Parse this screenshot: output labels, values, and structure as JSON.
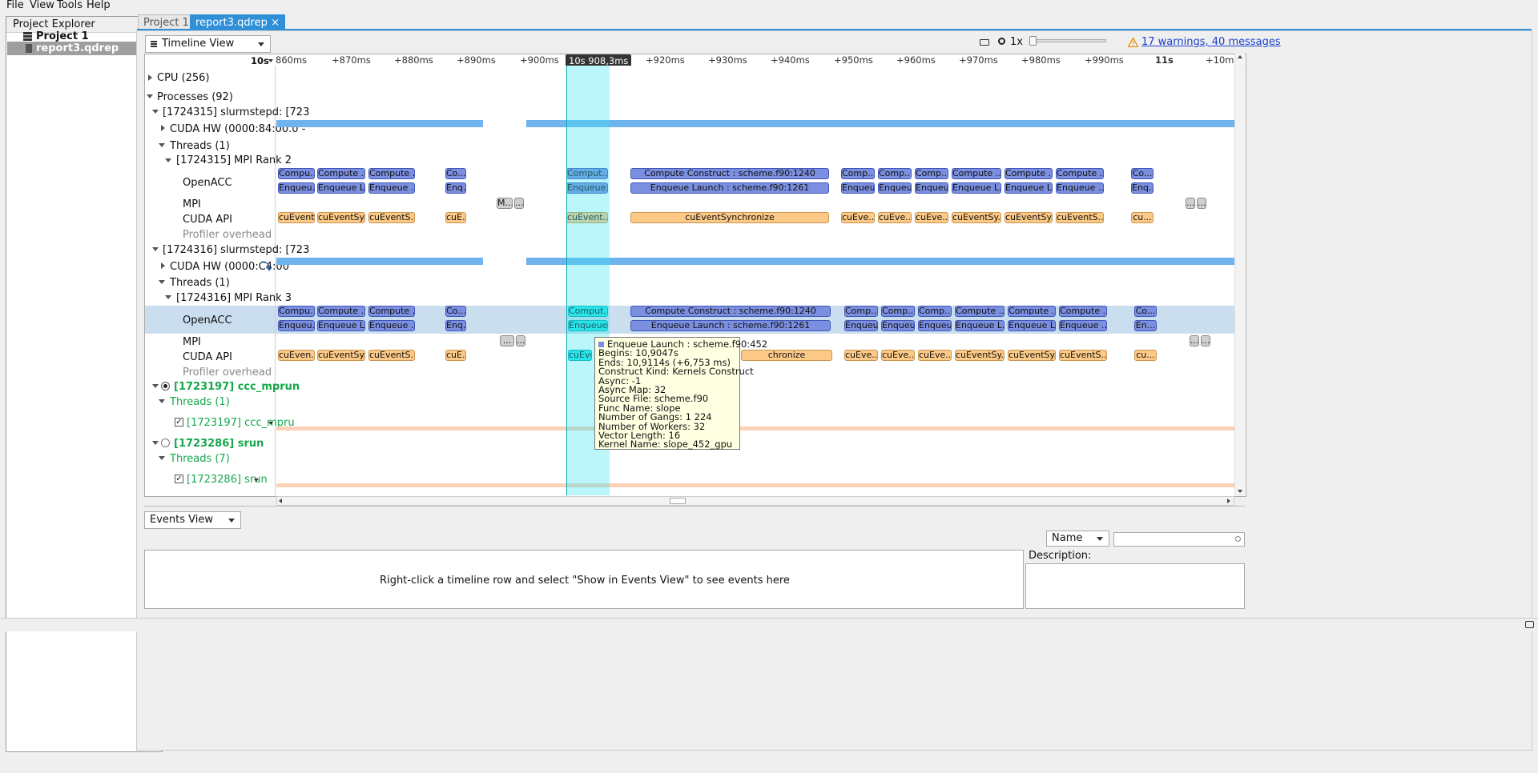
{
  "menu": [
    "File",
    "View",
    "Tools",
    "Help"
  ],
  "explorer": {
    "title": "Project Explorer",
    "close": "×",
    "items": [
      "Project 1",
      "report3.qdrep"
    ]
  },
  "tabs": [
    {
      "label": "Project 1",
      "close": "×"
    },
    {
      "label": "report3.qdrep",
      "close": "×"
    }
  ],
  "timeline_view": {
    "label": "Timeline View",
    "zoom": "1x",
    "warnings": "17 warnings, 40 messages"
  },
  "ruler": {
    "scale": "10s",
    "cursor": "10s 908,3ms",
    "ticks": [
      "860ms",
      "+870ms",
      "+880ms",
      "+890ms",
      "+900ms",
      "+920ms",
      "+930ms",
      "+940ms",
      "+950ms",
      "+960ms",
      "+970ms",
      "+980ms",
      "+990ms",
      "11s",
      "+10m"
    ]
  },
  "rows": [
    {
      "label": "CPU (256)"
    },
    {
      "label": "Processes (92)"
    },
    {
      "label": "[1724315] slurmstepd: [723"
    },
    {
      "label": "CUDA HW (0000:84:00.0 -"
    },
    {
      "label": "Threads (1)"
    },
    {
      "label": "[1724315] MPI Rank 2"
    },
    {
      "label": "OpenACC"
    },
    {
      "label": "MPI"
    },
    {
      "label": "CUDA API"
    },
    {
      "label": "Profiler overhead"
    },
    {
      "label": "[1724316] slurmstepd: [723"
    },
    {
      "label": "CUDA HW (0000:C4:00"
    },
    {
      "label": "Threads (1)"
    },
    {
      "label": "[1724316] MPI Rank 3"
    },
    {
      "label": "OpenACC"
    },
    {
      "label": "MPI"
    },
    {
      "label": "CUDA API"
    },
    {
      "label": "Profiler overhead"
    },
    {
      "label": "[1723197] ccc_mprun"
    },
    {
      "label": "Threads (1)"
    },
    {
      "label": "[1723197] ccc_mpru"
    },
    {
      "label": "[1723286] srun"
    },
    {
      "label": "Threads (7)"
    },
    {
      "label": "[1723286] srun"
    }
  ],
  "bars": {
    "compute_long": "Compute Construct : scheme.f90:1240",
    "enqueue_long": "Enqueue Launch : scheme.f90:1261",
    "cuevent_long": "cuEventSynchronize",
    "compute_short": "Compute ...",
    "compute_comp": "Comp...",
    "compute_co": "Co...",
    "compute_u": "Comput...",
    "enqueue_short": "Enqueue L...",
    "enqueue_e": "Enqueue ...",
    "enqueue_eq": "Enq...",
    "enqueue_eu": "Enqueu...",
    "enqueue_en": "En...",
    "cuevent_sy": "cuEventSy...",
    "cuevent_s": "cuEventS...",
    "cuevent_n": "cuEven...",
    "cuevent_e": "cuE...",
    "cuevent_eve": "cuEve...",
    "cuevent_cu": "cu...",
    "cuevent_t": "cuEvent...",
    "mpi_m": "M...",
    "dots": "...",
    "compute_pu": "Compu...",
    "cuevent_chr": "chronize",
    "cuevent_cue": "cuEve"
  },
  "tooltip": [
    "Enqueue Launch : scheme.f90:452",
    "Begins: 10,9047s",
    "Ends: 10,9114s (+6,753 ms)",
    "Construct Kind: Kernels Construct",
    "Async: -1",
    "Async Map: 32",
    "Source File: scheme.f90",
    "Func Name: slope",
    "Number of Gangs: 1 224",
    "Number of Workers: 32",
    "Vector Length: 16",
    "Kernel Name: slope_452_gpu"
  ],
  "events": {
    "view": "Events View",
    "message": "Right-click a timeline row and select \"Show in Events View\" to see events here",
    "sort": "Name",
    "description": "Description:"
  }
}
